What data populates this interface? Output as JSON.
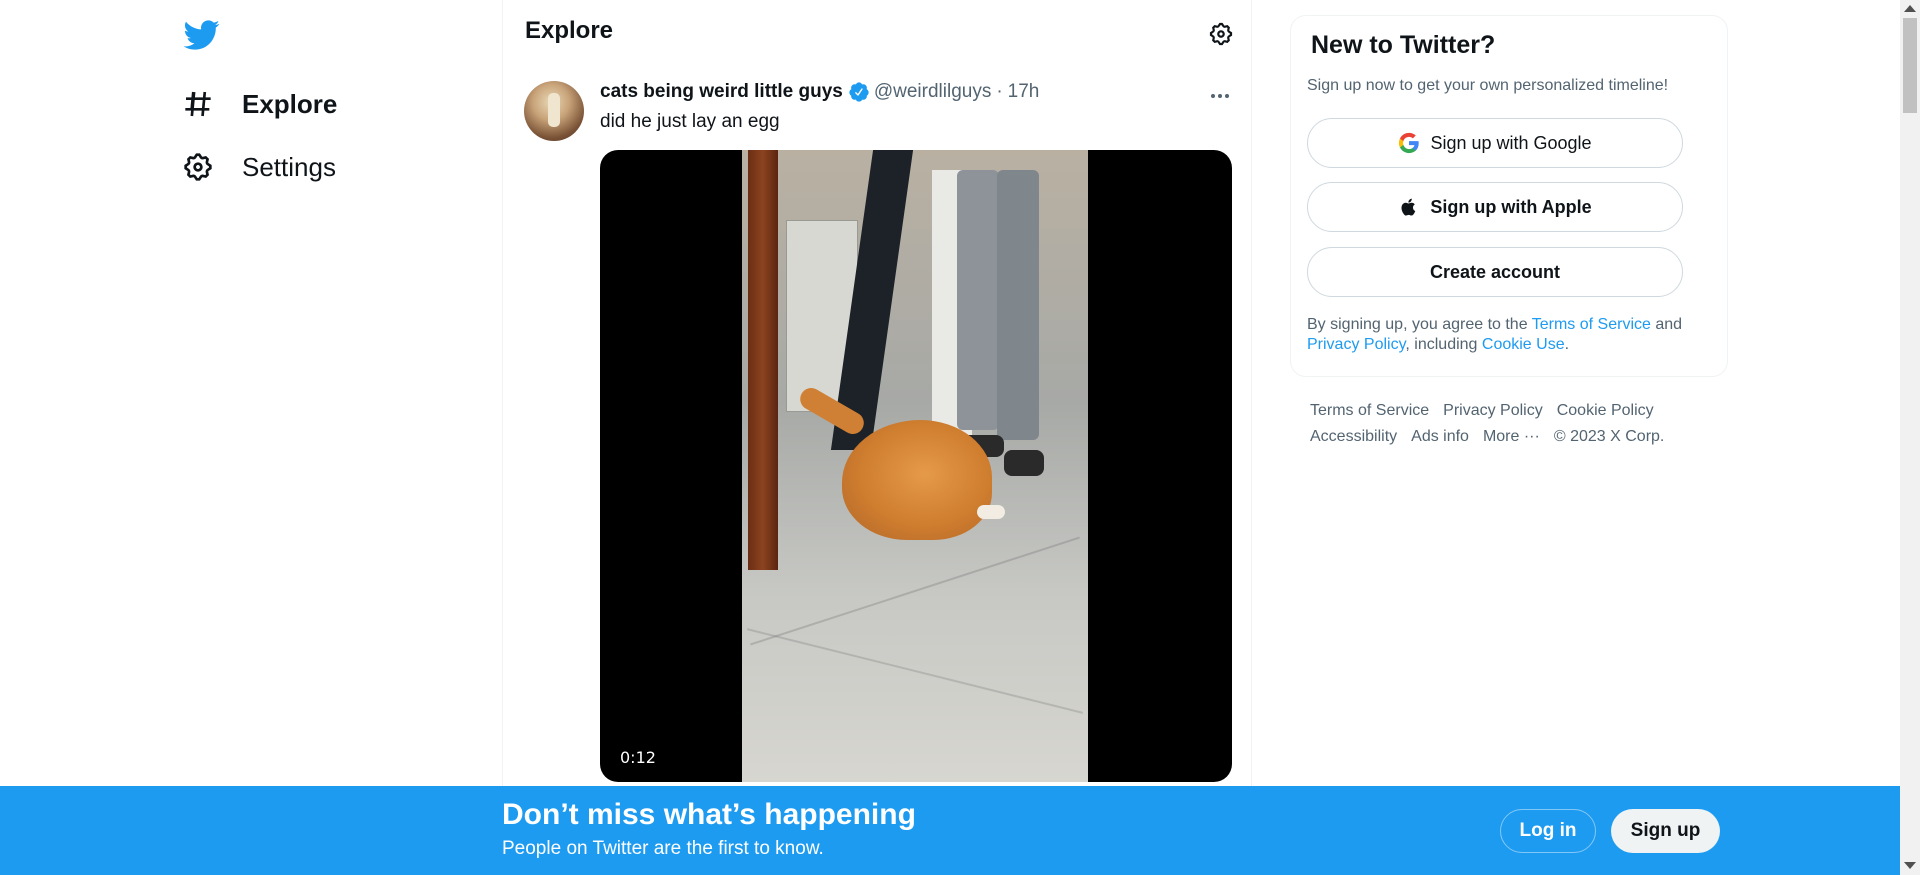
{
  "nav": {
    "logo_icon": "twitter-bird-icon",
    "items": [
      {
        "label": "Explore",
        "icon": "hashtag-icon",
        "active": true
      },
      {
        "label": "Settings",
        "icon": "gear-icon",
        "active": false
      }
    ]
  },
  "main": {
    "title": "Explore",
    "settings_icon": "gear-icon",
    "tweet": {
      "author": "cats being weird little guys",
      "verified": true,
      "handle": "@weirdlilguys",
      "separator": "·",
      "time": "17h",
      "text": "did he just lay an egg",
      "video_duration": "0:12"
    }
  },
  "sidebar": {
    "title": "New to Twitter?",
    "subtitle": "Sign up now to get your own personalized timeline!",
    "google_label": "Sign up with Google",
    "apple_label": "Sign up with Apple",
    "create_label": "Create account",
    "legal": {
      "prefix": "By signing up, you agree to the ",
      "terms": "Terms of Service",
      "and": " and ",
      "privacy": "Privacy Policy",
      "including": ", including ",
      "cookie": "Cookie Use",
      "end": "."
    },
    "footer_links": [
      "Terms of Service",
      "Privacy Policy",
      "Cookie Policy",
      "Accessibility",
      "Ads info",
      "More ···",
      "© 2023 X Corp."
    ]
  },
  "banner": {
    "title": "Don’t miss what’s happening",
    "subtitle": "People on Twitter are the first to know.",
    "login_label": "Log in",
    "signup_label": "Sign up"
  },
  "colors": {
    "brand": "#1d9bf0",
    "text_primary": "#0f1419",
    "text_secondary": "#536471"
  }
}
